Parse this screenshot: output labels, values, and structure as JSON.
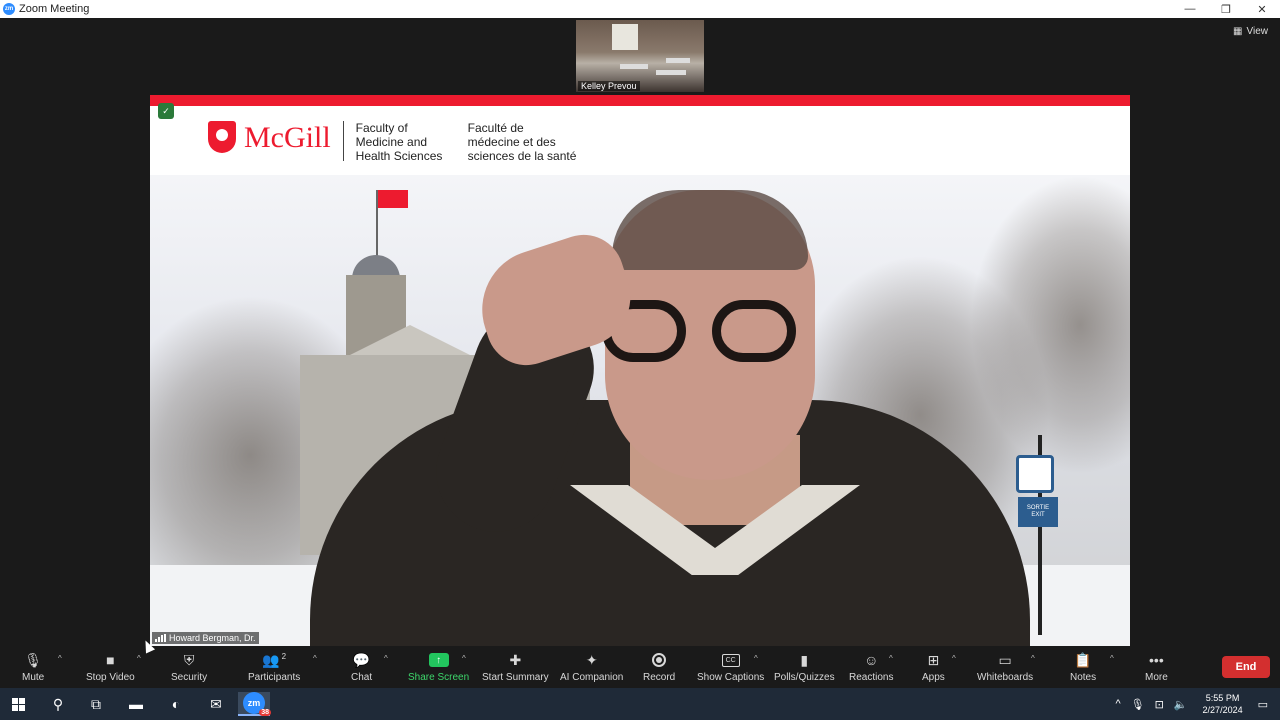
{
  "window": {
    "title": "Zoom Meeting",
    "app_icon": "zm",
    "controls": {
      "minimize": "—",
      "restore": "❐",
      "close": "✕"
    }
  },
  "stage": {
    "view_label": "View",
    "thumbnail": {
      "name": "Kelley Prevou"
    },
    "main_video": {
      "speaker_name": "Howard Bergman, Dr.",
      "background": {
        "brand": "McGill",
        "faculty_en": [
          "Faculty of",
          "Medicine and",
          "Health Sciences"
        ],
        "faculty_fr": [
          "Faculté de",
          "médecine et des",
          "sciences de la santé"
        ],
        "sign_text": [
          "SORTIE",
          "EXIT"
        ]
      }
    }
  },
  "toolbar": {
    "mute": "Mute",
    "stop_video": "Stop Video",
    "security": "Security",
    "participants": "Participants",
    "participant_count": "2",
    "chat": "Chat",
    "share_screen": "Share Screen",
    "start_summary": "Start Summary",
    "ai_companion": "AI Companion",
    "record": "Record",
    "show_captions": "Show Captions",
    "cc_glyph": "CC",
    "polls": "Polls/Quizzes",
    "reactions": "Reactions",
    "apps": "Apps",
    "whiteboards": "Whiteboards",
    "notes": "Notes",
    "more": "More",
    "end": "End",
    "accent_green": "#22c55e",
    "end_color": "#d32f2f"
  },
  "taskbar": {
    "zoom_label": "zm",
    "zoom_badge": "38",
    "time": "5:55 PM",
    "date": "2/27/2024"
  }
}
